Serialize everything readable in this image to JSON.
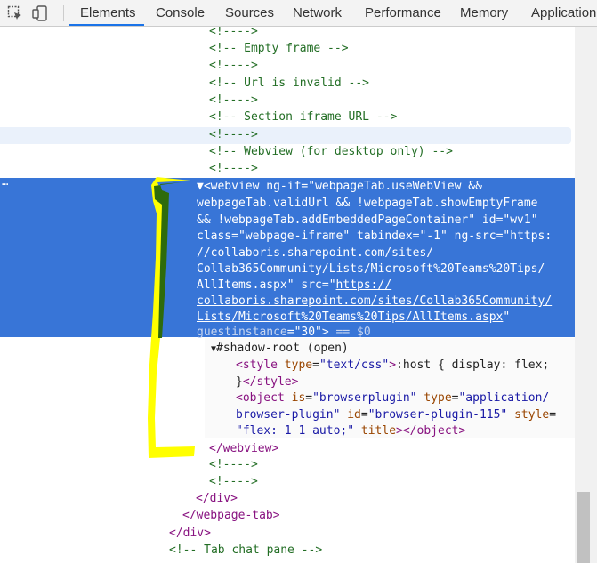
{
  "toolbar": {
    "tabs": [
      "Elements",
      "Console",
      "Sources",
      "Network",
      "Performance",
      "Memory",
      "Application"
    ],
    "active_tab": "Elements",
    "icons": [
      "inspect-element-icon",
      "device-toolbar-icon"
    ]
  },
  "lines": {
    "l1": "<!---->",
    "l2": "<!-- Empty frame -->",
    "l3": "<!---->",
    "l4": "<!-- Url is invalid -->",
    "l5": "<!---->",
    "l6": "<!-- Section iframe URL -->",
    "l7": "<!---->",
    "l8": "<!-- Webview (for desktop only) -->",
    "l9": "<!---->"
  },
  "webview": {
    "open_tag": "<webview",
    "a_ngif": "ng-if",
    "v_ngif_1": "\"webpageTab.useWebView &&",
    "v_ngif_2": "webpageTab.validUrl && !webpageTab.showEmptyFrame",
    "v_ngif_3": "&& !webpageTab.addEmbeddedPageContainer\"",
    "a_id": "id",
    "v_id": "\"wv1\"",
    "a_class": "class",
    "v_class": "\"webpage-iframe\"",
    "a_tabindex": "tabindex",
    "v_tabindex": "\"-1\"",
    "a_ngsrc": "ng-src",
    "v_ngsrc_1": "\"https:",
    "v_ngsrc_2": "//collaboris.sharepoint.com/sites/",
    "v_ngsrc_3": "Collab365Community/Lists/Microsoft%20Teams%20Tips/",
    "v_ngsrc_4": "AllItems.aspx\"",
    "a_src": "src",
    "v_src_q": "\"",
    "v_src_1": "https://",
    "v_src_2": "collaboris.sharepoint.com/sites/Collab365Community/",
    "v_src_3": "Lists/Microsoft%20Teams%20Tips/AllItems.aspx",
    "a_guest": "guestinstance",
    "v_guest": "\"30\"",
    "dollar": "== $0"
  },
  "shadow": {
    "root": "#shadow-root (open)",
    "style_open": "<style",
    "a_type": "type",
    "v_type": "\"text/css\"",
    "style_css_1": ":host { display: flex;",
    "style_css_2": "}",
    "style_close": "</style>",
    "obj_open": "<object",
    "a_is": "is",
    "v_is": "\"browserplugin\"",
    "a_otype": "type",
    "v_otype_1": "\"application/",
    "v_otype_2": "browser-plugin\"",
    "a_oid": "id",
    "v_oid": "\"browser-plugin-115\"",
    "a_ostyle": "style",
    "v_ostyle": "\"flex: 1 1 auto;\"",
    "a_title": "title",
    "obj_close": "</object>"
  },
  "tail": {
    "webview_close": "</webview>",
    "c1": "<!---->",
    "c2": "<!---->",
    "div_close_1": "</div>",
    "webpage_tab_close": "</webpage-tab>",
    "div_close_2": "</div>",
    "chat_comment": "<!-- Tab chat pane -->"
  },
  "colors": {
    "selection": "#3875d7",
    "comment": "#236e25",
    "tag": "#881280",
    "attr": "#994500",
    "value": "#1a1aa6",
    "annotation_yellow": "#ffff00",
    "annotation_green": "#2e6b0c"
  }
}
